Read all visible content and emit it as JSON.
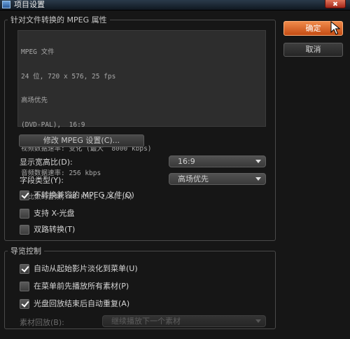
{
  "window": {
    "title": "项目设置"
  },
  "buttons": {
    "ok": "确定",
    "cancel": "取消",
    "modify_mpeg": "修改 MPEG 设置(C)..."
  },
  "mpeg_group": {
    "legend": "针对文件转换的 MPEG 属性",
    "info_lines": [
      "MPEG 文件",
      "24 位, 720 x 576, 25 fps",
      "高场优先",
      "(DVD-PAL),  16:9",
      "视频数据速率: 变化 (最大  8000 kbps)",
      "音频数据速率: 256 kbps",
      "杜比数码音频, 48 KHz, 2/0(L,R)"
    ],
    "aspect_label": "显示宽高比(D):",
    "aspect_value": "16:9",
    "field_label": "字段类型(Y):",
    "field_value": "高场优先",
    "checks": [
      {
        "label": "不转换兼容的 MPEG 文件(Q)",
        "checked": true
      },
      {
        "label": "支持 X-光盘",
        "checked": false
      },
      {
        "label": "双路转换(T)",
        "checked": false
      }
    ]
  },
  "nav_group": {
    "legend": "导览控制",
    "checks": [
      {
        "label": "自动从起始影片淡化到菜单(U)",
        "checked": true
      },
      {
        "label": "在菜单前先播放所有素材(P)",
        "checked": false
      },
      {
        "label": "光盘回放结束后自动重复(A)",
        "checked": true
      }
    ],
    "clip_playback_label": "素材回放(B):",
    "clip_playback_value": "继续播放下一个素材"
  }
}
